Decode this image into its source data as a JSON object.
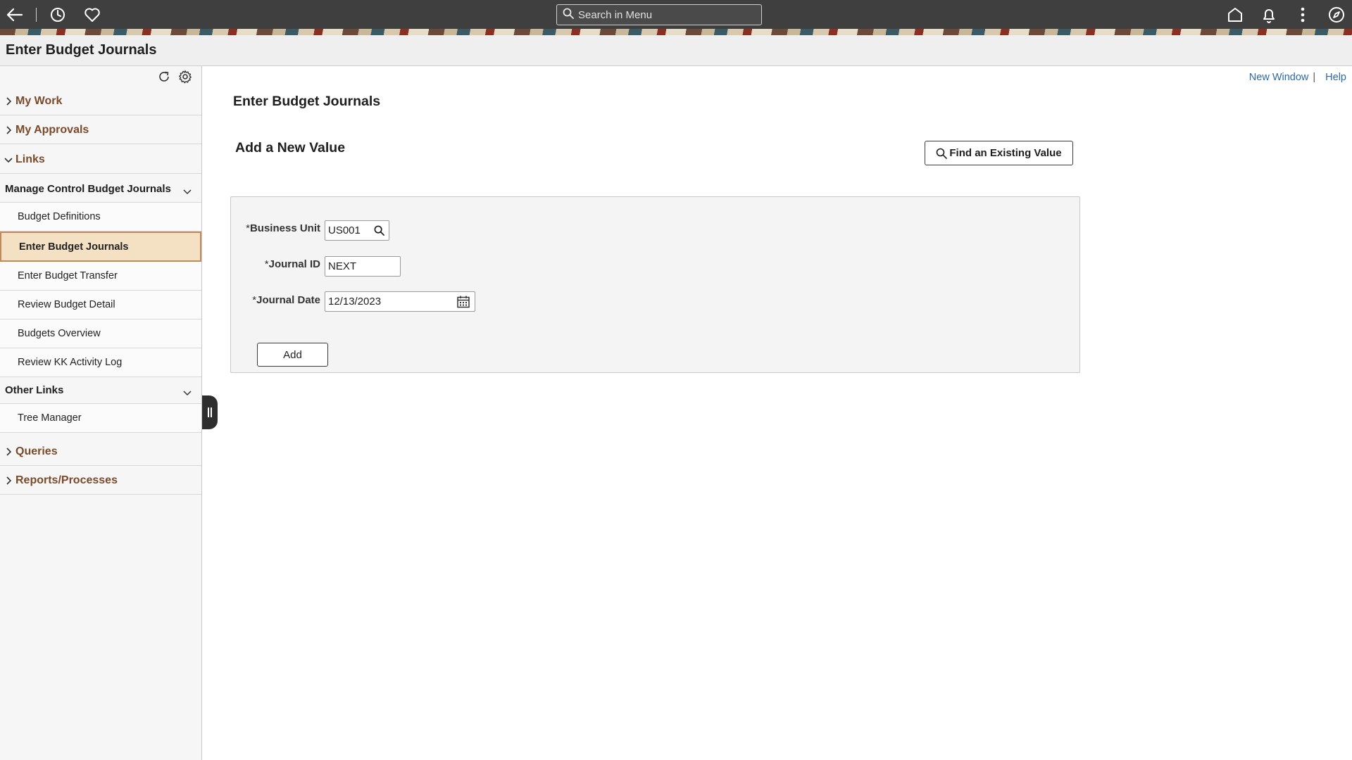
{
  "header": {
    "search_placeholder": "Search in Menu",
    "icons": [
      "back-icon",
      "history-icon",
      "favorites-icon",
      "search-icon",
      "home-icon",
      "notifications-icon",
      "more-options-icon",
      "navigator-icon"
    ]
  },
  "page": {
    "title": "Enter Budget Journals"
  },
  "sidebar": {
    "tools": [
      "refresh-icon",
      "settings-icon"
    ],
    "sections": {
      "my_work": "My Work",
      "my_approvals": "My Approvals",
      "links": "Links",
      "queries": "Queries",
      "reports": "Reports/Processes"
    },
    "groups": {
      "manage_control": {
        "label": "Manage Control Budget Journals",
        "items": [
          "Budget Definitions",
          "Enter Budget Journals",
          "Enter Budget Transfer",
          "Review Budget Detail",
          "Budgets Overview",
          "Review KK Activity Log"
        ]
      },
      "other_links": {
        "label": "Other Links",
        "items": [
          "Tree Manager"
        ]
      }
    },
    "active_item": "Enter Budget Journals"
  },
  "main": {
    "links": {
      "new_window": "New Window",
      "separator": "|",
      "help": "Help"
    },
    "title": "Enter Budget Journals",
    "subtitle": "Add a New Value",
    "find_button": "Find an Existing Value",
    "form": {
      "business_unit": {
        "required": "*",
        "label": "Business Unit",
        "value": "US001"
      },
      "journal_id": {
        "required": "*",
        "label": "Journal ID",
        "value": "NEXT"
      },
      "journal_date": {
        "required": "*",
        "label": "Journal Date",
        "value": "12/13/2023"
      },
      "add_button": "Add"
    }
  },
  "colors": {
    "header_bg": "#3f3f3f",
    "section_label": "#7a4a2a",
    "active_item_bg": "#f4e0c2",
    "link": "#2b6aa6"
  }
}
